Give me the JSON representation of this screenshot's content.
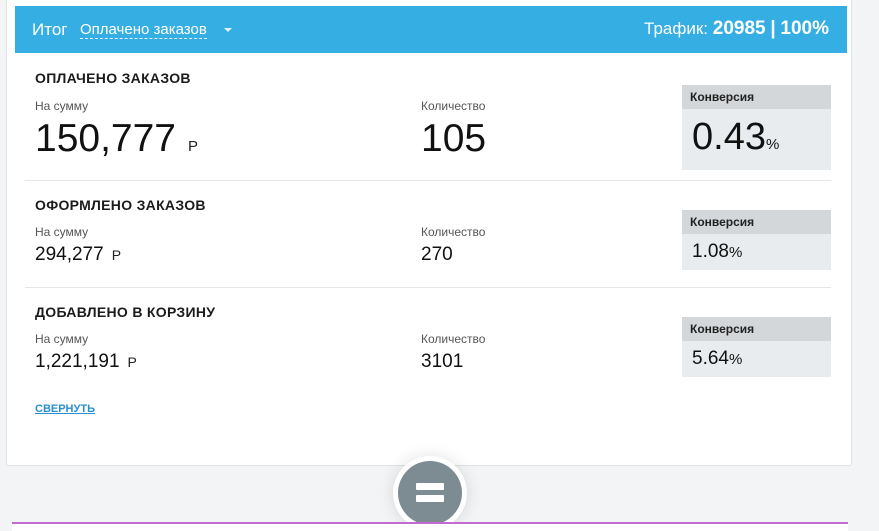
{
  "header": {
    "label": "Итог",
    "dropdown_value": "Оплачено заказов",
    "traffic_label": "Трафик:",
    "traffic_value": "20985",
    "traffic_sep": "|",
    "traffic_percent": "100%",
    "bg_color": "#35aee3"
  },
  "sections": [
    {
      "title": "ОПЛАЧЕНО ЗАКАЗОВ",
      "sum_label": "На сумму",
      "sum_value": "150,777",
      "currency": "Р",
      "qty_label": "Количество",
      "qty_value": "105",
      "conv_label": "Конверсия",
      "conv_value": "0.43",
      "conv_unit": "%"
    },
    {
      "title": "ОФОРМЛЕНО ЗАКАЗОВ",
      "sum_label": "На сумму",
      "sum_value": "294,277",
      "currency": "Р",
      "qty_label": "Количество",
      "qty_value": "270",
      "conv_label": "Конверсия",
      "conv_value": "1.08",
      "conv_unit": "%"
    },
    {
      "title": "ДОБАВЛЕНО В КОРЗИНУ",
      "sum_label": "На сумму",
      "sum_value": "1,221,191",
      "currency": "Р",
      "qty_label": "Количество",
      "qty_value": "3101",
      "conv_label": "Конверсия",
      "conv_value": "5.64",
      "conv_unit": "%"
    }
  ],
  "collapse_label": "СВЕРНУТЬ",
  "icons": {
    "dropdown": "chevron-down-icon",
    "equals": "equals-icon"
  }
}
